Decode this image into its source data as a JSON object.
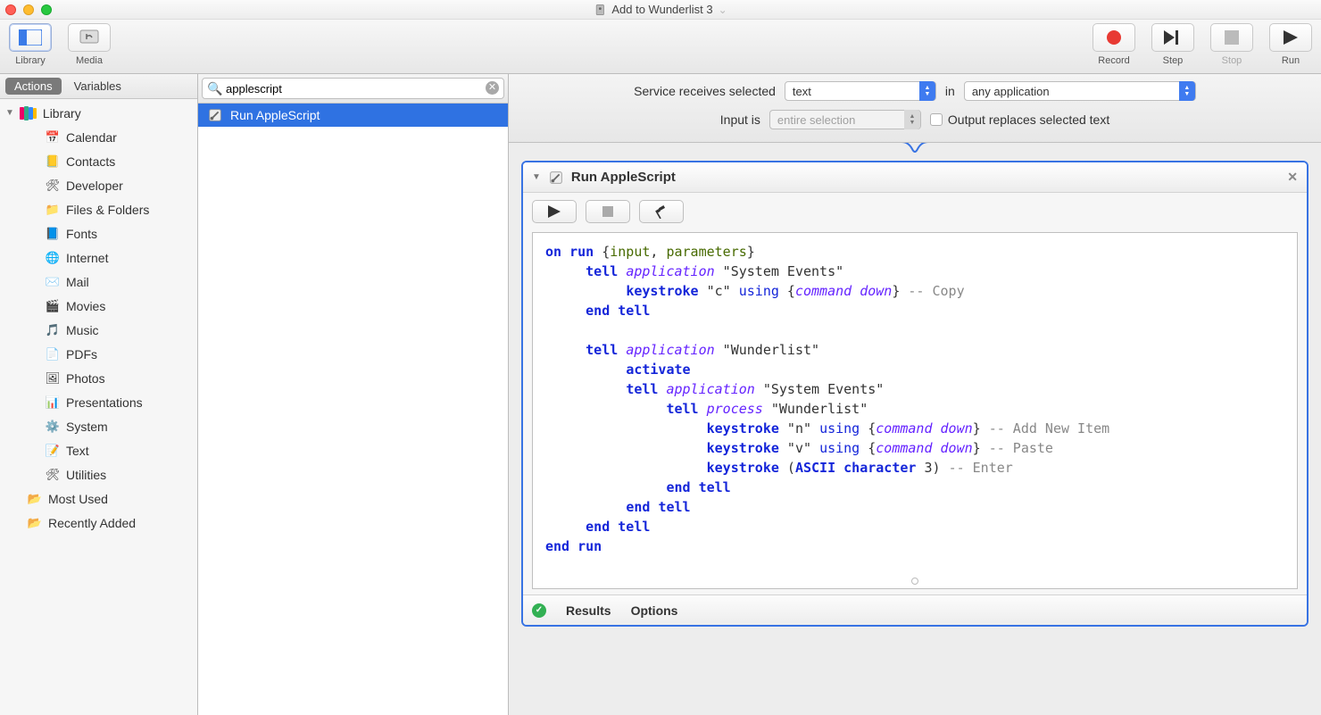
{
  "window": {
    "title": "Add to Wunderlist 3"
  },
  "toolbar_left": [
    {
      "name": "library-button",
      "label": "Library",
      "active": true
    },
    {
      "name": "media-button",
      "label": "Media",
      "active": false
    }
  ],
  "toolbar_right": [
    {
      "name": "record-button",
      "label": "Record",
      "enabled": true
    },
    {
      "name": "step-button",
      "label": "Step",
      "enabled": true
    },
    {
      "name": "stop-button",
      "label": "Stop",
      "enabled": false
    },
    {
      "name": "run-button",
      "label": "Run",
      "enabled": true
    }
  ],
  "lib_tabs": {
    "actions": "Actions",
    "variables": "Variables",
    "selected": "actions"
  },
  "search": {
    "placeholder": "",
    "value": "applescript"
  },
  "library_root": "Library",
  "categories": [
    {
      "name": "Calendar",
      "glyph": "📅"
    },
    {
      "name": "Contacts",
      "glyph": "📒"
    },
    {
      "name": "Developer",
      "glyph": "🛠"
    },
    {
      "name": "Files & Folders",
      "glyph": "📁"
    },
    {
      "name": "Fonts",
      "glyph": "📘"
    },
    {
      "name": "Internet",
      "glyph": "🌐"
    },
    {
      "name": "Mail",
      "glyph": "✉️"
    },
    {
      "name": "Movies",
      "glyph": "🎬"
    },
    {
      "name": "Music",
      "glyph": "🎵"
    },
    {
      "name": "PDFs",
      "glyph": "📄"
    },
    {
      "name": "Photos",
      "glyph": "🖼"
    },
    {
      "name": "Presentations",
      "glyph": "📊"
    },
    {
      "name": "System",
      "glyph": "⚙️"
    },
    {
      "name": "Text",
      "glyph": "📝"
    },
    {
      "name": "Utilities",
      "glyph": "🛠"
    }
  ],
  "smart_lists": [
    {
      "name": "Most Used",
      "glyph": "📂"
    },
    {
      "name": "Recently Added",
      "glyph": "📂"
    }
  ],
  "actions": [
    {
      "name": "Run AppleScript",
      "selected": true
    }
  ],
  "service_bar": {
    "label_receives": "Service receives selected",
    "input_type": "text",
    "in_label": "in",
    "app": "any application",
    "input_is_label": "Input is",
    "input_scope": "entire selection",
    "output_replaces_label": "Output replaces selected text",
    "output_replaces_checked": false
  },
  "card": {
    "title": "Run AppleScript",
    "footer": {
      "results": "Results",
      "options": "Options",
      "status_ok": true
    }
  },
  "script": {
    "tokens": [
      [
        [
          "kw",
          "on"
        ],
        [
          "sp",
          " "
        ],
        [
          "kw",
          "run"
        ],
        [
          "sp",
          " {"
        ],
        [
          "var",
          "input"
        ],
        [
          "sp",
          ", "
        ],
        [
          "var",
          "parameters"
        ],
        [
          "sp",
          "}"
        ]
      ],
      [
        [
          "ind",
          1
        ],
        [
          "kw",
          "tell"
        ],
        [
          "sp",
          " "
        ],
        [
          "prop",
          "application"
        ],
        [
          "sp",
          " \"System Events\""
        ]
      ],
      [
        [
          "ind",
          2
        ],
        [
          "kw",
          "keystroke"
        ],
        [
          "sp",
          " \"c\" "
        ],
        [
          "kwnb",
          "using"
        ],
        [
          "sp",
          " {"
        ],
        [
          "prop",
          "command down"
        ],
        [
          "sp",
          "} "
        ],
        [
          "cmt",
          "-- Copy"
        ]
      ],
      [
        [
          "ind",
          1
        ],
        [
          "kw",
          "end"
        ],
        [
          "sp",
          " "
        ],
        [
          "kw",
          "tell"
        ]
      ],
      [
        [
          "blank"
        ]
      ],
      [
        [
          "ind",
          1
        ],
        [
          "kw",
          "tell"
        ],
        [
          "sp",
          " "
        ],
        [
          "prop",
          "application"
        ],
        [
          "sp",
          " \"Wunderlist\""
        ]
      ],
      [
        [
          "ind",
          2
        ],
        [
          "kw",
          "activate"
        ]
      ],
      [
        [
          "ind",
          2
        ],
        [
          "kw",
          "tell"
        ],
        [
          "sp",
          " "
        ],
        [
          "prop",
          "application"
        ],
        [
          "sp",
          " \"System Events\""
        ]
      ],
      [
        [
          "ind",
          3
        ],
        [
          "kw",
          "tell"
        ],
        [
          "sp",
          " "
        ],
        [
          "prop",
          "process"
        ],
        [
          "sp",
          " \"Wunderlist\""
        ]
      ],
      [
        [
          "ind",
          4
        ],
        [
          "kw",
          "keystroke"
        ],
        [
          "sp",
          " \"n\" "
        ],
        [
          "kwnb",
          "using"
        ],
        [
          "sp",
          " {"
        ],
        [
          "prop",
          "command down"
        ],
        [
          "sp",
          "} "
        ],
        [
          "cmt",
          "-- Add New Item"
        ]
      ],
      [
        [
          "ind",
          4
        ],
        [
          "kw",
          "keystroke"
        ],
        [
          "sp",
          " \"v\" "
        ],
        [
          "kwnb",
          "using"
        ],
        [
          "sp",
          " {"
        ],
        [
          "prop",
          "command down"
        ],
        [
          "sp",
          "} "
        ],
        [
          "cmt",
          "-- Paste"
        ]
      ],
      [
        [
          "ind",
          4
        ],
        [
          "kw",
          "keystroke"
        ],
        [
          "sp",
          " ("
        ],
        [
          "kw",
          "ASCII character"
        ],
        [
          "sp",
          " 3) "
        ],
        [
          "cmt",
          "-- Enter"
        ]
      ],
      [
        [
          "ind",
          3
        ],
        [
          "kw",
          "end"
        ],
        [
          "sp",
          " "
        ],
        [
          "kw",
          "tell"
        ]
      ],
      [
        [
          "ind",
          2
        ],
        [
          "kw",
          "end"
        ],
        [
          "sp",
          " "
        ],
        [
          "kw",
          "tell"
        ]
      ],
      [
        [
          "ind",
          1
        ],
        [
          "kw",
          "end"
        ],
        [
          "sp",
          " "
        ],
        [
          "kw",
          "tell"
        ]
      ],
      [
        [
          "kw",
          "end"
        ],
        [
          "sp",
          " "
        ],
        [
          "kw",
          "run"
        ]
      ]
    ]
  }
}
